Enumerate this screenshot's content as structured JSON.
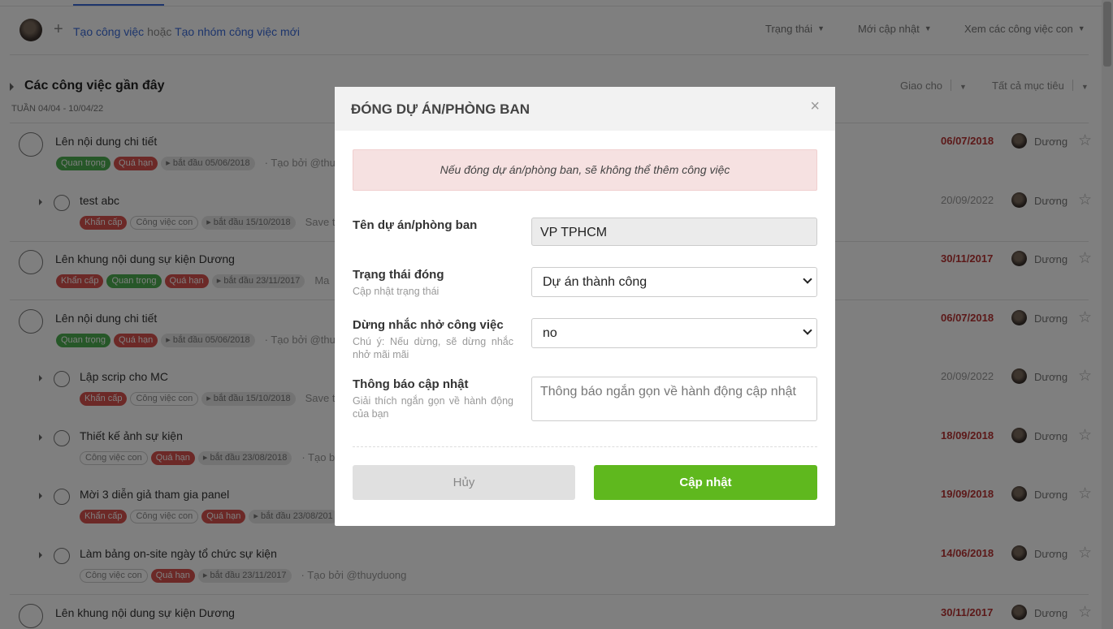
{
  "toolbar": {
    "create_task": "Tạo công việc",
    "or": "hoặc",
    "create_group": "Tạo nhóm công việc mới",
    "filters": [
      "Trạng thái",
      "Mới cập nhật",
      "Xem các công việc con"
    ]
  },
  "section": {
    "title": "Các công việc gần đây",
    "week": "TUẦN 04/04 - 10/04/22",
    "filter_assign": "Giao cho",
    "filter_target": "Tất cả mục tiêu"
  },
  "tasks": [
    {
      "title": "Lên nội dung chi tiết",
      "tags": [
        "Quan trọng",
        "Quá hạn",
        "bắt đầu 05/06/2018"
      ],
      "creator": "· Tạo bởi @thuydu",
      "date": "06/07/2018",
      "user": "Dương"
    },
    {
      "title": "test abc",
      "tags": [
        "Khẩn cấp",
        "Công việc con",
        "bắt đầu 15/10/2018"
      ],
      "creator": "Save t",
      "date": "20/09/2022",
      "user": "Dương"
    },
    {
      "title": "Lên khung nội dung sự kiện Dương",
      "tags": [
        "Khẩn cấp",
        "Quan trọng",
        "Quá hạn",
        "bắt đầu 23/11/2017"
      ],
      "creator": "Ma",
      "date": "30/11/2017",
      "user": "Dương"
    },
    {
      "title": "Lên nội dung chi tiết",
      "tags": [
        "Quan trọng",
        "Quá hạn",
        "bắt đầu 05/06/2018"
      ],
      "creator": "· Tạo bởi @thu",
      "date": "06/07/2018",
      "user": "Dương"
    },
    {
      "title": "Lập scrip cho MC",
      "tags": [
        "Khẩn cấp",
        "Công việc con",
        "bắt đầu 15/10/2018"
      ],
      "creator": "Save t",
      "date": "20/09/2022",
      "user": "Dương"
    },
    {
      "title": "Thiết kế ảnh sự kiện",
      "tags": [
        "Công việc con",
        "Quá hạn",
        "bắt đầu 23/08/2018"
      ],
      "creator": "· Tạo b",
      "date": "18/09/2018",
      "user": "Dương"
    },
    {
      "title": "Mời 3 diễn giả tham gia panel",
      "tags": [
        "Khẩn cấp",
        "Công việc con",
        "Quá hạn",
        "bắt đầu 23/08/201"
      ],
      "creator": "",
      "date": "19/09/2018",
      "user": "Dương"
    },
    {
      "title": "Làm bảng on-site ngày tổ chức sự kiện",
      "tags": [
        "Công việc con",
        "Quá hạn",
        "bắt đầu 23/11/2017"
      ],
      "creator": "· Tạo bởi @thuyduong",
      "date": "14/06/2018",
      "user": "Dương"
    },
    {
      "title": "Lên khung nội dung sự kiện Dương",
      "tags": [],
      "creator": "",
      "date": "30/11/2017",
      "user": "Dương"
    }
  ],
  "modal": {
    "title": "ĐÓNG DỰ ÁN/PHÒNG BAN",
    "close_icon": "×",
    "alert": "Nếu đóng dự án/phòng ban, sẽ không thể thêm công việc",
    "name_label": "Tên dự án/phòng ban",
    "name_value": "VP TPHCM",
    "status_label": "Trạng thái đóng",
    "status_hint": "Cập nhật trạng thái",
    "status_value": "Dự án thành công",
    "reminder_label": "Dừng nhắc nhở công việc",
    "reminder_hint": "Chú ý: Nếu dừng, sẽ dừng nhắc nhở mãi mãi",
    "reminder_value": "no",
    "notice_label": "Thông báo cập nhật",
    "notice_hint": "Giải thích ngắn gọn về hành động của bạn",
    "notice_placeholder": "Thông báo ngắn gọn về hành động cập nhật",
    "cancel": "Hủy",
    "submit": "Cập nhật"
  },
  "colors": {
    "accent_link": "#3a6bd8",
    "submit_green": "#5fb81e",
    "overdue_red": "#b83232",
    "tag_green": "#4caf50",
    "tag_red": "#d9534f"
  }
}
